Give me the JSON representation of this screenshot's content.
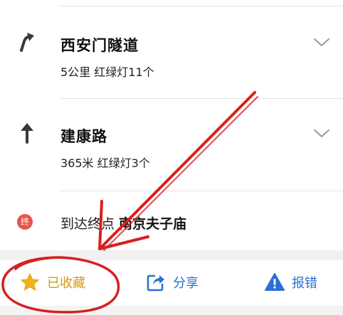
{
  "route": {
    "steps": [
      {
        "icon": "turn-right-arrow-icon",
        "title": "西安门隧道",
        "detail": "5公里  红绿灯11个"
      },
      {
        "icon": "straight-arrow-icon",
        "title": "建康路",
        "detail": "365米  红绿灯3个"
      }
    ],
    "end": {
      "badge": "终",
      "prefix": "到达终点",
      "destination": "南京夫子庙",
      "badge_color": "#e8534a"
    }
  },
  "toolbar": {
    "favorite": {
      "label": "已收藏",
      "icon": "star-icon",
      "color": "#d19a13"
    },
    "share": {
      "label": "分享",
      "icon": "share-icon",
      "color": "#2b6fd6"
    },
    "report": {
      "label": "报错",
      "icon": "warning-icon",
      "color": "#2b6fd6"
    }
  },
  "annotation": {
    "color": "#d62020",
    "shapes": [
      "arrow",
      "circle"
    ]
  }
}
